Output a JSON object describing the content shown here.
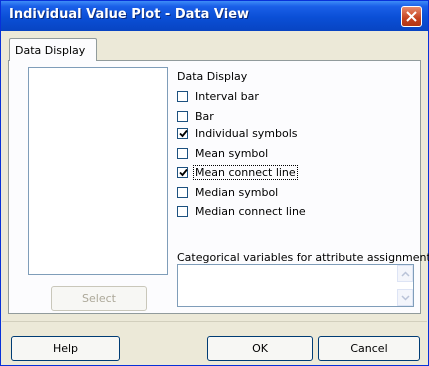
{
  "window": {
    "title": "Individual Value Plot - Data View"
  },
  "tabs": [
    {
      "label": "Data Display"
    }
  ],
  "variables_list": {
    "items": []
  },
  "select_button": {
    "label": "Select",
    "enabled": false
  },
  "data_display": {
    "group_label": "Data Display",
    "options": [
      {
        "label": "Interval bar",
        "checked": false
      },
      {
        "label": "Bar",
        "checked": false
      },
      {
        "label": "Individual symbols",
        "checked": true
      },
      {
        "label": "Mean symbol",
        "checked": false
      },
      {
        "label": "Mean connect line",
        "checked": true
      },
      {
        "label": "Median symbol",
        "checked": false
      },
      {
        "label": "Median connect line",
        "checked": false
      }
    ]
  },
  "categorical": {
    "label": "Categorical variables for attribute assignment:",
    "value": ""
  },
  "footer": {
    "help_label": "Help",
    "ok_label": "OK",
    "cancel_label": "Cancel"
  },
  "colors": {
    "title_bar": "#0a4fd6",
    "dialog_bg": "#ece9d8",
    "close_button": "#c4421f"
  }
}
